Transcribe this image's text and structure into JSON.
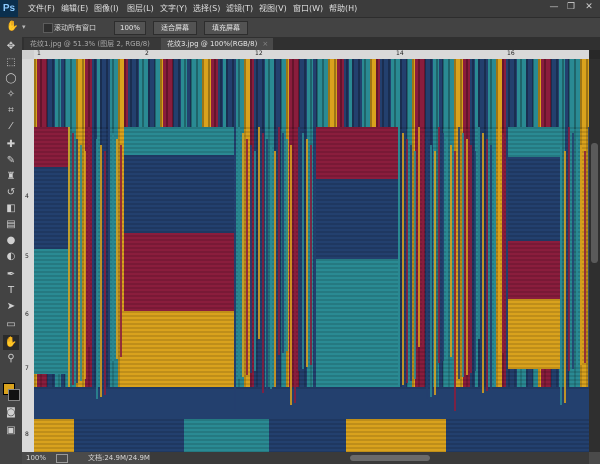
{
  "app": {
    "logo": "Ps"
  },
  "menu": [
    "文件(F)",
    "编辑(E)",
    "图像(I)",
    "图层(L)",
    "文字(Y)",
    "选择(S)",
    "滤镜(T)",
    "视图(V)",
    "窗口(W)",
    "帮助(H)"
  ],
  "window_controls": {
    "minimize": "—",
    "restore": "❐",
    "close": "✕"
  },
  "options_bar": {
    "hand_icon": "✋",
    "dropdown_arrow": "▾",
    "scroll_all_label": "滚动所有窗口",
    "zoom_button": "100%",
    "fit_screen_button": "适合屏幕",
    "fill_screen_button": "填充屏幕"
  },
  "tabs": [
    {
      "label": "花纹1.jpg @ 51.3% (图层 2, RGB/8) *",
      "close": "×"
    },
    {
      "label": "花纹3.jpg @ 100%(RGB/8)",
      "close": "×"
    }
  ],
  "ruler": {
    "h_labels": [
      "1",
      "2",
      "12",
      "14",
      "16"
    ],
    "v_labels": [
      "4",
      "5",
      "6",
      "7",
      "8"
    ]
  },
  "status": {
    "zoom": "100%",
    "doc": "文档:24.9M/24.9M",
    "arrow": "▶"
  },
  "colors": {
    "teal": "#2a8a93",
    "navy": "#23406e",
    "crimson": "#8a1d3d",
    "gold": "#d9a21d",
    "foreground_swatch": "#d9a21d",
    "background_swatch": "#111111"
  },
  "tools": [
    "move-icon",
    "marquee-icon",
    "lasso-icon",
    "magic-wand-icon",
    "crop-icon",
    "eyedropper-icon",
    "healing-brush-icon",
    "brush-icon",
    "clone-stamp-icon",
    "history-brush-icon",
    "eraser-icon",
    "gradient-icon",
    "blur-icon",
    "dodge-icon",
    "pen-icon",
    "type-icon",
    "path-selection-icon",
    "rectangle-icon",
    "hand-icon",
    "zoom-icon"
  ]
}
